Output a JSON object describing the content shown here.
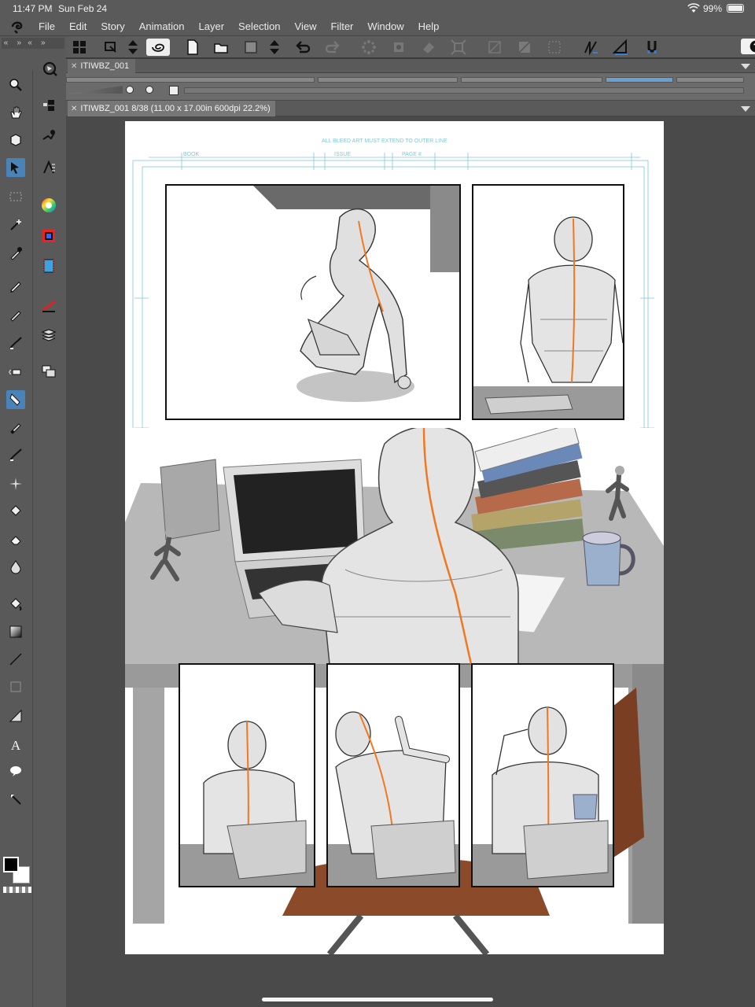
{
  "status": {
    "time": "11:47 PM",
    "date": "Sun Feb 24",
    "battery": "99%"
  },
  "menu": [
    "File",
    "Edit",
    "Story",
    "Animation",
    "Layer",
    "Selection",
    "View",
    "Filter",
    "Window",
    "Help"
  ],
  "tabs": {
    "project": "ITIWBZ_001",
    "document": "ITIWBZ_001 8/38 (11.00 x 17.00in 600dpi 22.2%)"
  },
  "page_guides": {
    "bleed_note": "ALL BLEED ART MUST EXTEND TO OUTER LINE",
    "book": "BOOK",
    "issue": "ISSUE",
    "page": "PAGE #"
  },
  "icons": {
    "toolbar": [
      "grid-icon",
      "transform-icon",
      "arrows-icon",
      "swirl-icon",
      "new-page-icon",
      "open-icon",
      "save-icon",
      "updown-icon",
      "undo-icon",
      "redo-icon",
      "spinner-icon",
      "stamp-icon",
      "eraser-icon",
      "crop-icon",
      "grid-disabled-icon",
      "fill-disabled-icon",
      "dots-icon",
      "pen-sync-icon",
      "ruler-icon",
      "magnet-icon",
      "help-icon"
    ],
    "tools": [
      "zoom-icon",
      "hand-icon",
      "rotate-icon",
      "move-icon",
      "marquee-icon",
      "magic-wand-icon",
      "eyedropper-icon",
      "pen-icon",
      "pencil-icon",
      "brush-icon",
      "airbrush-icon",
      "decoration-icon",
      "blend-icon",
      "sparkle-icon",
      "eraser-icon",
      "blend-drop-icon",
      "fill-icon",
      "gradient-icon",
      "line-icon",
      "frame-icon",
      "ruler-icon",
      "text-icon",
      "balloon-icon",
      "correct-icon"
    ],
    "panels": [
      "navigator-icon",
      "layer-props-icon",
      "sub-tool-icon",
      "tool-property-icon",
      "color-wheel-icon",
      "color-set-icon",
      "animation-icon",
      "brush-size-icon",
      "layers-icon",
      "material-icon"
    ]
  },
  "colors": {
    "accent": "#4a83b8",
    "panel_bg": "#5a5a5a",
    "guide": "#7fc9d9",
    "highlight": "#f07820"
  }
}
